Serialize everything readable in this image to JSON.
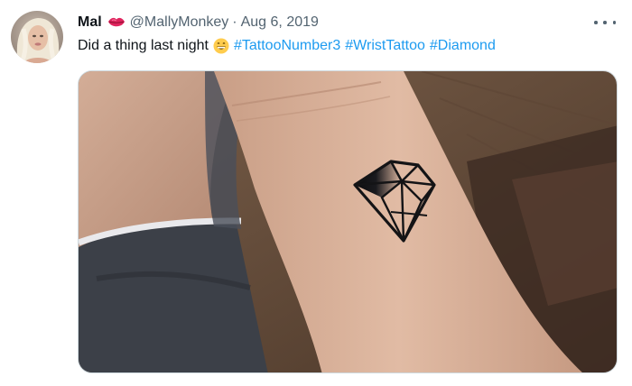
{
  "tweet": {
    "author": {
      "display_name": "Mal",
      "handle": "@MallyMonkey",
      "avatar_icon": "profile-avatar",
      "badge_icon": "kiss-lips-emoji"
    },
    "separator": "·",
    "date": "Aug 6, 2019",
    "text_prefix": "Did a thing last night",
    "emoji_icon": "grinning-face-emoji",
    "hashtags": [
      "#TattooNumber3",
      "#WristTattoo",
      "#Diamond"
    ],
    "menu_icon": "more-options-icon",
    "media": {
      "description_icon": "photo-wrist-diamond-tattoo"
    }
  },
  "colors": {
    "link": "#1d9bf0",
    "secondary_text": "#536471",
    "primary_text": "#0f1419"
  }
}
